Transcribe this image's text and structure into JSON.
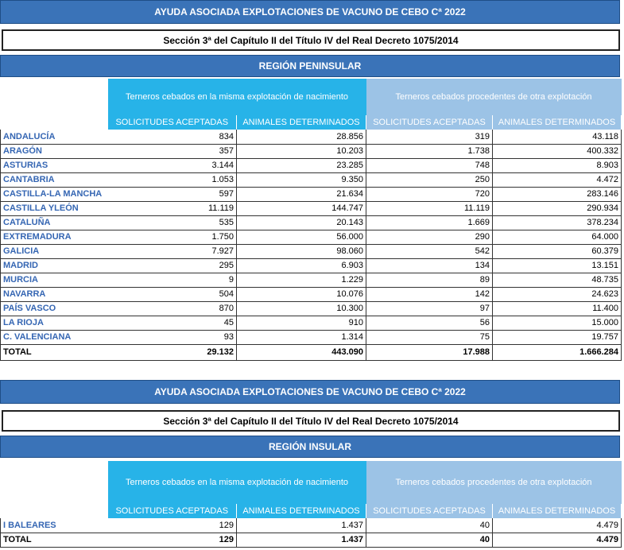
{
  "peninsular": {
    "title": "AYUDA ASOCIADA EXPLOTACIONES DE VACUNO DE CEBO Cª 2022",
    "subtitle": "Sección 3ª del Capítulo II del Título IV del Real Decreto 1075/2014",
    "region": "REGIÓN PENINSULAR",
    "group_a": "Terneros cebados en la misma explotación de nacimiento",
    "group_b": "Terneros cebados procedentes de otra explotación",
    "col_headers": [
      "SOLICITUDES ACEPTADAS",
      "ANIMALES DETERMINADOS",
      "SOLICITUDES ACEPTADAS",
      "ANIMALES DETERMINADOS"
    ],
    "rows": [
      [
        "ANDALUCÍA",
        "834",
        "28.856",
        "319",
        "43.118"
      ],
      [
        "ARAGÓN",
        "357",
        "10.203",
        "1.738",
        "400.332"
      ],
      [
        "ASTURIAS",
        "3.144",
        "23.285",
        "748",
        "8.903"
      ],
      [
        "CANTABRIA",
        "1.053",
        "9.350",
        "250",
        "4.472"
      ],
      [
        "CASTILLA-LA MANCHA",
        "597",
        "21.634",
        "720",
        "283.146"
      ],
      [
        "CASTILLA YLEÓN",
        "11.119",
        "144.747",
        "11.119",
        "290.934"
      ],
      [
        "CATALUÑA",
        "535",
        "20.143",
        "1.669",
        "378.234"
      ],
      [
        "EXTREMADURA",
        "1.750",
        "56.000",
        "290",
        "64.000"
      ],
      [
        "GALICIA",
        "7.927",
        "98.060",
        "542",
        "60.379"
      ],
      [
        "MADRID",
        "295",
        "6.903",
        "134",
        "13.151"
      ],
      [
        "MURCIA",
        "9",
        "1.229",
        "89",
        "48.735"
      ],
      [
        "NAVARRA",
        "504",
        "10.076",
        "142",
        "24.623"
      ],
      [
        "PAÍS VASCO",
        "870",
        "10.300",
        "97",
        "11.400"
      ],
      [
        "LA RIOJA",
        "45",
        "910",
        "56",
        "15.000"
      ],
      [
        "C. VALENCIANA",
        "93",
        "1.314",
        "75",
        "19.757"
      ]
    ],
    "total": [
      "TOTAL",
      "29.132",
      "443.090",
      "17.988",
      "1.666.284"
    ]
  },
  "insular": {
    "title": "AYUDA ASOCIADA EXPLOTACIONES DE VACUNO DE CEBO Cª 2022",
    "subtitle": "Sección 3ª del Capítulo II del Título IV del Real Decreto 1075/2014",
    "region": "REGIÓN INSULAR",
    "group_a": "Terneros cebados en la misma explotación de nacimiento",
    "group_b": "Terneros cebados procedentes de otra explotación",
    "col_headers": [
      "SOLICITUDES ACEPTADAS",
      "ANIMALES DETERMINADOS",
      "SOLICITUDES ACEPTADAS",
      "ANIMALES DETERMINADOS"
    ],
    "rows": [
      [
        "I BALEARES",
        "129",
        "1.437",
        "40",
        "4.479"
      ]
    ],
    "total": [
      "TOTAL",
      "129",
      "1.437",
      "40",
      "4.479"
    ]
  },
  "colors": {
    "title_bar": "#3a73b8",
    "group_a": "#27b3e8",
    "group_b": "#9cc3e6",
    "region_name": "#3566b3"
  }
}
